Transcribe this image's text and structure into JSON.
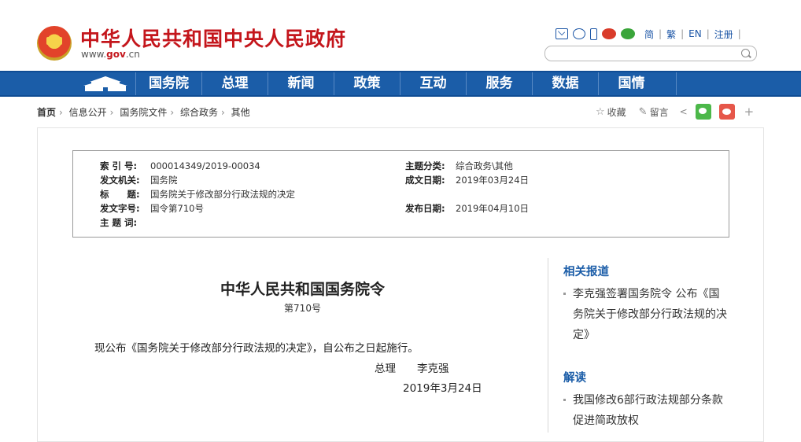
{
  "header": {
    "site_title": "中华人民共和国中央人民政府",
    "domain_prefix": "www.",
    "domain_mid": "gov",
    "domain_suffix": ".cn",
    "links": [
      "简",
      "繁",
      "EN",
      "注册"
    ],
    "search_placeholder": ""
  },
  "nav": {
    "items": [
      "国务院",
      "总理",
      "新闻",
      "政策",
      "互动",
      "服务",
      "数据",
      "国情"
    ]
  },
  "breadcrumb": [
    "首页",
    "信息公开",
    "国务院文件",
    "综合政务",
    "其他"
  ],
  "share": {
    "collect": "收藏",
    "comment": "留言",
    "plus": "+"
  },
  "meta": {
    "index_label": "索 引 号:",
    "index_value": "000014349/2019-00034",
    "topic_label": "主题分类:",
    "topic_value": "综合政务\\其他",
    "issuer_label": "发文机关:",
    "issuer_value": "国务院",
    "written_label": "成文日期:",
    "written_value": "2019年03月24日",
    "title_label": "标　　题:",
    "title_value": "国务院关于修改部分行政法规的决定",
    "docno_label": "发文字号:",
    "docno_value": "国令第710号",
    "published_label": "发布日期:",
    "published_value": "2019年04月10日",
    "keywords_label": "主 题 词:",
    "keywords_value": ""
  },
  "article": {
    "title": "中华人民共和国国务院令",
    "number": "第710号",
    "body": "现公布《国务院关于修改部分行政法规的决定》，自公布之日起施行。",
    "signature": "总理　　李克强",
    "date": "2019年3月24日"
  },
  "sidebar": {
    "related_heading": "相关报道",
    "related_items": [
      "李克强签署国务院令 公布《国务院关于修改部分行政法规的决定》"
    ],
    "interpretation_heading": "解读",
    "interpretation_items": [
      "我国修改6部行政法规部分条款促进简政放权"
    ]
  },
  "colors": {
    "brand_red": "#c4161c",
    "nav_blue": "#1b5da8"
  }
}
